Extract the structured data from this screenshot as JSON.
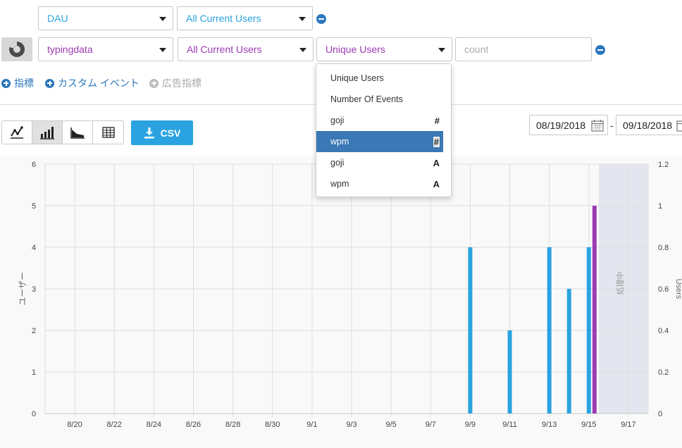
{
  "query_row1": {
    "metric": "DAU",
    "segment": "All Current Users"
  },
  "query_row2": {
    "event": "typingdata",
    "segment": "All Current Users",
    "measure": "Unique Users",
    "property_placeholder": "count"
  },
  "add_links": {
    "metric": "指標",
    "custom_event": "カスタム イベント",
    "ad_metric": "広告指標"
  },
  "toolbar": {
    "csv_label": "CSV",
    "view_buttons": [
      "line-chart",
      "bar-chart",
      "area-chart",
      "table"
    ],
    "active_view": "bar-chart"
  },
  "date_range": {
    "start": "08/19/2018",
    "separator": "-",
    "end": "09/18/2018"
  },
  "dropdown": {
    "items": [
      {
        "label": "Unique Users",
        "type_icon": ""
      },
      {
        "label": "Number Of Events",
        "type_icon": ""
      },
      {
        "label": "goji",
        "type_icon": "#"
      },
      {
        "label": "wpm",
        "type_icon": "#",
        "selected": true
      },
      {
        "label": "goji",
        "type_icon": "A"
      },
      {
        "label": "wpm",
        "type_icon": "A"
      }
    ]
  },
  "colors": {
    "accent_blue": "#2aa3e0",
    "purple": "#9b3bb3",
    "selected_blue": "#3a78b6",
    "processing_band": "#e3e6ee"
  },
  "chart_data": {
    "type": "bar",
    "ylabel": "ユーザー",
    "y2label": "Users",
    "processing_label": "処理中",
    "ylim": [
      0,
      6
    ],
    "y2lim": [
      0,
      1.2
    ],
    "yticks": [
      0,
      1,
      2,
      3,
      4,
      5,
      6
    ],
    "y2ticks": [
      "0",
      "0.2",
      "0.4",
      "0.6",
      "0.8",
      "1",
      "1.2"
    ],
    "x_tick_labels": [
      "8/20",
      "8/22",
      "8/24",
      "8/26",
      "8/28",
      "8/30",
      "9/1",
      "9/3",
      "9/5",
      "9/7",
      "9/9",
      "9/11",
      "9/13",
      "9/15",
      "9/17"
    ],
    "x_start": "08/19/2018",
    "x_end": "09/18/2018",
    "processing_from": "09/16/2018",
    "grid": true,
    "series": [
      {
        "axis": "left",
        "color": "#2aa3e0",
        "points": [
          {
            "date": "09/09/2018",
            "value": 4
          },
          {
            "date": "09/11/2018",
            "value": 2
          },
          {
            "date": "09/13/2018",
            "value": 4
          },
          {
            "date": "09/14/2018",
            "value": 3
          },
          {
            "date": "09/15/2018",
            "value": 4
          }
        ]
      },
      {
        "axis": "right",
        "color": "#9b3bb3",
        "points": [
          {
            "date": "09/15/2018",
            "value": 1
          }
        ]
      }
    ]
  }
}
